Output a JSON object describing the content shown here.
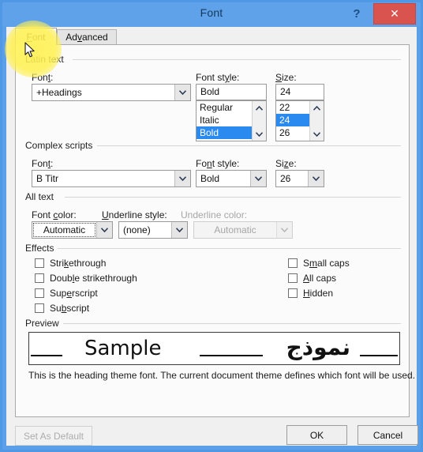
{
  "window": {
    "title": "Font",
    "help_label": "?",
    "close_label": "✕",
    "accent_blue": "#5fa2e9",
    "close_red": "#d9534f",
    "highlight_yellow": "#fff154",
    "selection_blue": "#2a8af0"
  },
  "tabs": [
    {
      "label": "Font",
      "selected": true
    },
    {
      "label": "Advanced",
      "selected": false
    }
  ],
  "latin_text": {
    "group_label": "Latin text",
    "font_label": "Font:",
    "font_value": "+Headings",
    "style_label": "Font style:",
    "style_value": "Bold",
    "style_options": [
      "Regular",
      "Italic",
      "Bold"
    ],
    "style_selected": "Bold",
    "size_label": "Size:",
    "size_value": "24",
    "size_options": [
      "22",
      "24",
      "26"
    ],
    "size_selected": "24"
  },
  "complex_scripts": {
    "group_label": "Complex scripts",
    "font_label": "Font:",
    "font_value": "B Titr",
    "style_label": "Font style:",
    "style_value": "Bold",
    "size_label": "Size:",
    "size_value": "26"
  },
  "all_text": {
    "group_label": "All text",
    "font_color_label": "Font color:",
    "font_color_value": "Automatic",
    "underline_style_label": "Underline style:",
    "underline_style_value": "(none)",
    "underline_color_label": "Underline color:",
    "underline_color_value": "Automatic",
    "underline_color_disabled": true
  },
  "effects": {
    "group_label": "Effects",
    "left": [
      {
        "label": "Strikethrough",
        "checked": false
      },
      {
        "label": "Double strikethrough",
        "checked": false
      },
      {
        "label": "Superscript",
        "checked": false
      },
      {
        "label": "Subscript",
        "checked": false
      }
    ],
    "right": [
      {
        "label": "Small caps",
        "checked": false
      },
      {
        "label": "All caps",
        "checked": false
      },
      {
        "label": "Hidden",
        "checked": false
      }
    ]
  },
  "preview": {
    "group_label": "Preview",
    "latin_sample": "Sample",
    "complex_sample": "نموذج",
    "note": "This is the heading theme font. The current document theme defines which font will be used."
  },
  "footer": {
    "set_as_default": "Set As Default",
    "set_as_default_disabled": true,
    "ok": "OK",
    "cancel": "Cancel"
  }
}
